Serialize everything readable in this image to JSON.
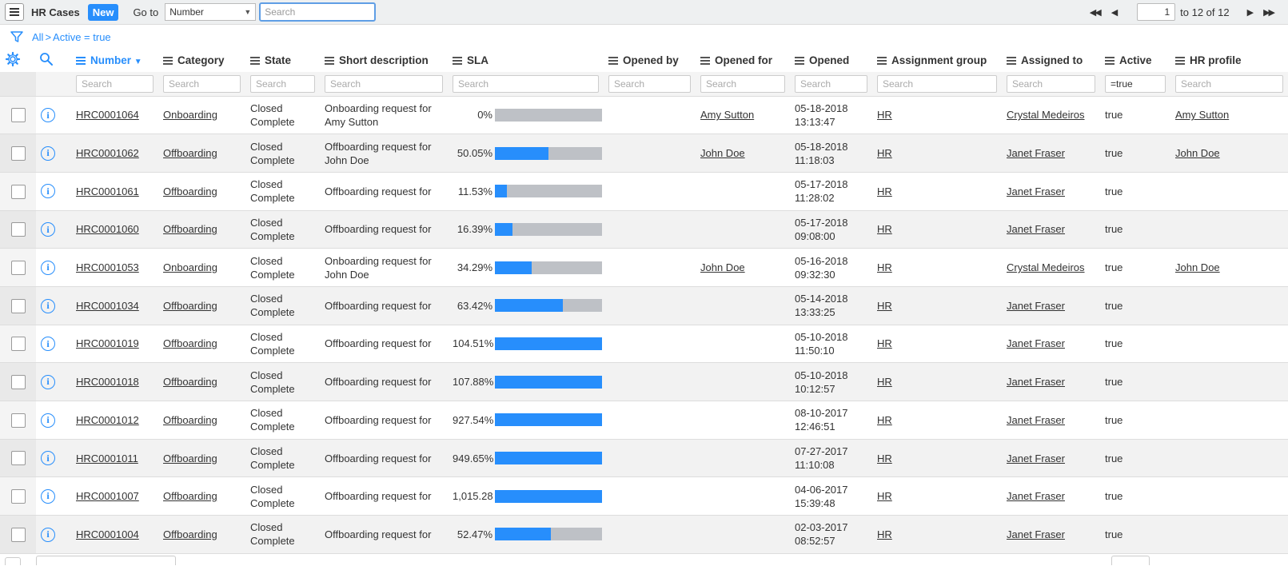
{
  "header": {
    "title": "HR Cases",
    "new_label": "New",
    "goto_label": "Go to",
    "goto_field": "Number",
    "search_placeholder": "Search",
    "page_current": "1",
    "page_range": "to 12 of 12"
  },
  "breadcrumb": {
    "root": "All",
    "separator": ">",
    "filter": "Active = true"
  },
  "columns": [
    {
      "label": "Number",
      "sorted": true
    },
    {
      "label": "Category"
    },
    {
      "label": "State"
    },
    {
      "label": "Short description"
    },
    {
      "label": "SLA"
    },
    {
      "label": "Opened by"
    },
    {
      "label": "Opened for"
    },
    {
      "label": "Opened"
    },
    {
      "label": "Assignment group"
    },
    {
      "label": "Assigned to"
    },
    {
      "label": "Active"
    },
    {
      "label": "HR profile"
    }
  ],
  "column_search": {
    "placeholder": "Search",
    "active_value": "=true"
  },
  "rows": [
    {
      "number": "HRC0001064",
      "category": "Onboarding",
      "state1": "Closed",
      "state2": "Complete",
      "desc1": "Onboarding request for",
      "desc2": "Amy Sutton",
      "sla": "0%",
      "sla_fill": 0,
      "opened_by": "",
      "opened_for": "Amy Sutton",
      "opened_date": "05-18-2018",
      "opened_time": "13:13:47",
      "group": "HR",
      "assigned": "Crystal Medeiros",
      "active": "true",
      "profile": "Amy Sutton"
    },
    {
      "number": "HRC0001062",
      "category": "Offboarding",
      "state1": "Closed",
      "state2": "Complete",
      "desc1": "Offboarding request for",
      "desc2": "John Doe",
      "sla": "50.05%",
      "sla_fill": 50.05,
      "opened_by": "",
      "opened_for": "John Doe",
      "opened_date": "05-18-2018",
      "opened_time": "11:18:03",
      "group": "HR",
      "assigned": "Janet Fraser",
      "active": "true",
      "profile": "John Doe"
    },
    {
      "number": "HRC0001061",
      "category": "Offboarding",
      "state1": "Closed",
      "state2": "Complete",
      "desc1": "Offboarding request for",
      "desc2": "",
      "sla": "11.53%",
      "sla_fill": 11.53,
      "opened_by": "",
      "opened_for": "",
      "opened_date": "05-17-2018",
      "opened_time": "11:28:02",
      "group": "HR",
      "assigned": "Janet Fraser",
      "active": "true",
      "profile": ""
    },
    {
      "number": "HRC0001060",
      "category": "Offboarding",
      "state1": "Closed",
      "state2": "Complete",
      "desc1": "Offboarding request for",
      "desc2": "",
      "sla": "16.39%",
      "sla_fill": 16.39,
      "opened_by": "",
      "opened_for": "",
      "opened_date": "05-17-2018",
      "opened_time": "09:08:00",
      "group": "HR",
      "assigned": "Janet Fraser",
      "active": "true",
      "profile": ""
    },
    {
      "number": "HRC0001053",
      "category": "Onboarding",
      "state1": "Closed",
      "state2": "Complete",
      "desc1": "Onboarding request for",
      "desc2": "John Doe",
      "sla": "34.29%",
      "sla_fill": 34.29,
      "opened_by": "",
      "opened_for": "John Doe",
      "opened_date": "05-16-2018",
      "opened_time": "09:32:30",
      "group": "HR",
      "assigned": "Crystal Medeiros",
      "active": "true",
      "profile": "John Doe"
    },
    {
      "number": "HRC0001034",
      "category": "Offboarding",
      "state1": "Closed",
      "state2": "Complete",
      "desc1": "Offboarding request for",
      "desc2": "",
      "sla": "63.42%",
      "sla_fill": 63.42,
      "opened_by": "",
      "opened_for": "",
      "opened_date": "05-14-2018",
      "opened_time": "13:33:25",
      "group": "HR",
      "assigned": "Janet Fraser",
      "active": "true",
      "profile": ""
    },
    {
      "number": "HRC0001019",
      "category": "Offboarding",
      "state1": "Closed",
      "state2": "Complete",
      "desc1": "Offboarding request for",
      "desc2": "",
      "sla": "104.51%",
      "sla_fill": 100,
      "opened_by": "",
      "opened_for": "",
      "opened_date": "05-10-2018",
      "opened_time": "11:50:10",
      "group": "HR",
      "assigned": "Janet Fraser",
      "active": "true",
      "profile": ""
    },
    {
      "number": "HRC0001018",
      "category": "Offboarding",
      "state1": "Closed",
      "state2": "Complete",
      "desc1": "Offboarding request for",
      "desc2": "",
      "sla": "107.88%",
      "sla_fill": 100,
      "opened_by": "",
      "opened_for": "",
      "opened_date": "05-10-2018",
      "opened_time": "10:12:57",
      "group": "HR",
      "assigned": "Janet Fraser",
      "active": "true",
      "profile": ""
    },
    {
      "number": "HRC0001012",
      "category": "Offboarding",
      "state1": "Closed",
      "state2": "Complete",
      "desc1": "Offboarding request for",
      "desc2": "",
      "sla": "927.54%",
      "sla_fill": 100,
      "opened_by": "",
      "opened_for": "",
      "opened_date": "08-10-2017",
      "opened_time": "12:46:51",
      "group": "HR",
      "assigned": "Janet Fraser",
      "active": "true",
      "profile": ""
    },
    {
      "number": "HRC0001011",
      "category": "Offboarding",
      "state1": "Closed",
      "state2": "Complete",
      "desc1": "Offboarding request for",
      "desc2": "",
      "sla": "949.65%",
      "sla_fill": 100,
      "opened_by": "",
      "opened_for": "",
      "opened_date": "07-27-2017",
      "opened_time": "11:10:08",
      "group": "HR",
      "assigned": "Janet Fraser",
      "active": "true",
      "profile": ""
    },
    {
      "number": "HRC0001007",
      "category": "Offboarding",
      "state1": "Closed",
      "state2": "Complete",
      "desc1": "Offboarding request for",
      "desc2": "",
      "sla": "1,015.28",
      "sla_fill": 100,
      "opened_by": "",
      "opened_for": "",
      "opened_date": "04-06-2017",
      "opened_time": "15:39:48",
      "group": "HR",
      "assigned": "Janet Fraser",
      "active": "true",
      "profile": ""
    },
    {
      "number": "HRC0001004",
      "category": "Offboarding",
      "state1": "Closed",
      "state2": "Complete",
      "desc1": "Offboarding request for",
      "desc2": "",
      "sla": "52.47%",
      "sla_fill": 52.47,
      "opened_by": "",
      "opened_for": "",
      "opened_date": "02-03-2017",
      "opened_time": "08:52:57",
      "group": "HR",
      "assigned": "Janet Fraser",
      "active": "true",
      "profile": ""
    }
  ],
  "icons": {
    "menu": "hamburger-icon",
    "filter": "funnel-icon",
    "settings": "gear-icon",
    "search": "magnifier-icon",
    "info": "info-circle-icon",
    "sort_desc": "caret-down-icon"
  },
  "colors": {
    "accent": "#278efc",
    "sla_empty": "#bec1c6"
  }
}
